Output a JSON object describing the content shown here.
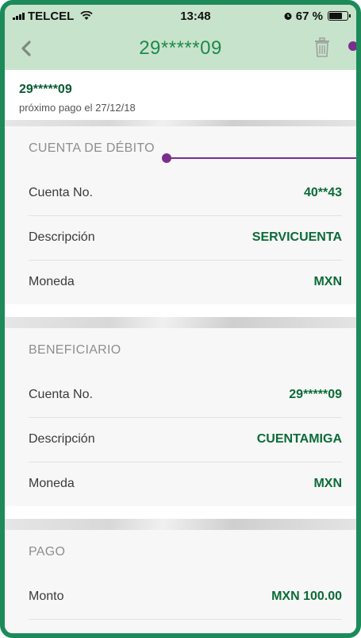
{
  "status_bar": {
    "carrier": "TELCEL",
    "time": "13:48",
    "battery_text": "67 %"
  },
  "nav": {
    "title": "29*****09"
  },
  "account": {
    "number": "29*****09",
    "next_payment": "próximo pago el 27/12/18"
  },
  "debit_account": {
    "title": "CUENTA DE DÉBITO",
    "rows": [
      {
        "label": "Cuenta No.",
        "value": "40**43"
      },
      {
        "label": "Descripción",
        "value": "SERVICUENTA"
      },
      {
        "label": "Moneda",
        "value": "MXN"
      }
    ]
  },
  "beneficiary": {
    "title": "BENEFICIARIO",
    "rows": [
      {
        "label": "Cuenta No.",
        "value": "29*****09"
      },
      {
        "label": "Descripción",
        "value": "CUENTAMIGA"
      },
      {
        "label": "Moneda",
        "value": "MXN"
      }
    ]
  },
  "payment": {
    "title": "PAGO",
    "rows": [
      {
        "label": "Monto",
        "value": "MXN 100.00"
      }
    ]
  },
  "colors": {
    "frame": "#1d8a5a",
    "header_bg": "#c8e3cb",
    "title_green": "#1e8a4c",
    "value_green": "#0b6b37",
    "annotation": "#7a2e8e"
  },
  "icons": {
    "back": "chevron-left-icon",
    "delete": "trash-icon",
    "wifi": "wifi-icon",
    "alarm": "alarm-icon",
    "battery": "battery-icon",
    "signal": "signal-icon"
  }
}
